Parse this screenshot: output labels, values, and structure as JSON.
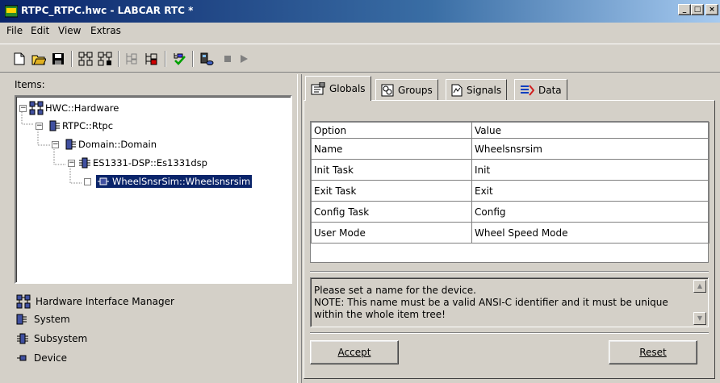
{
  "window": {
    "title": "RTPC_RTPC.hwc - LABCAR RTC  *",
    "minimize": "_",
    "maximize": "□",
    "close": "×"
  },
  "menu": [
    "File",
    "Edit",
    "View",
    "Extras"
  ],
  "toolbar_icons": [
    "new-icon",
    "open-icon",
    "save-icon",
    "hw-tree-icon",
    "hw-tree2-icon",
    "connect-icon",
    "disconnect-icon",
    "check-icon",
    "build-icon",
    "stop-icon",
    "play-icon"
  ],
  "left": {
    "items_label": "Items:",
    "tree": [
      {
        "label": "HWC::Hardware",
        "level": 0,
        "expander": "−"
      },
      {
        "label": "RTPC::Rtpc",
        "level": 1,
        "expander": "−"
      },
      {
        "label": "Domain::Domain",
        "level": 2,
        "expander": "−"
      },
      {
        "label": "ES1331-DSP::Es1331dsp",
        "level": 3,
        "expander": "−"
      },
      {
        "label": "WheelSnsrSim::Wheelsnsrsim",
        "level": 4,
        "expander": "",
        "selected": true
      }
    ],
    "legend": [
      {
        "label": "Hardware Interface Manager",
        "icon": "hardware-manager-icon"
      },
      {
        "label": "System",
        "icon": "system-icon"
      },
      {
        "label": "Subsystem",
        "icon": "subsystem-icon"
      },
      {
        "label": "Device",
        "icon": "device-icon"
      }
    ]
  },
  "tabs": [
    {
      "label": "Globals",
      "icon": "globals-icon",
      "active": true
    },
    {
      "label": "Groups",
      "icon": "groups-icon"
    },
    {
      "label": "Signals",
      "icon": "signals-icon"
    },
    {
      "label": "Data",
      "icon": "data-icon"
    }
  ],
  "grid": {
    "headers": [
      "Option",
      "Value"
    ],
    "rows": [
      [
        "Name",
        "Wheelsnsrsim"
      ],
      [
        "Init Task",
        "Init"
      ],
      [
        "Exit Task",
        "Exit"
      ],
      [
        "Config Task",
        "Config"
      ],
      [
        "User Mode",
        "Wheel Speed Mode"
      ]
    ]
  },
  "description": {
    "line1": "Please set a name for the device.",
    "line2": "NOTE: This name must be a valid ANSI-C identifier and it must be unique",
    "line3": "within the whole item tree!"
  },
  "buttons": {
    "accept": "Accept",
    "reset": "Reset"
  },
  "colors": {
    "selection": "#0a246a",
    "face": "#d4d0c8"
  }
}
